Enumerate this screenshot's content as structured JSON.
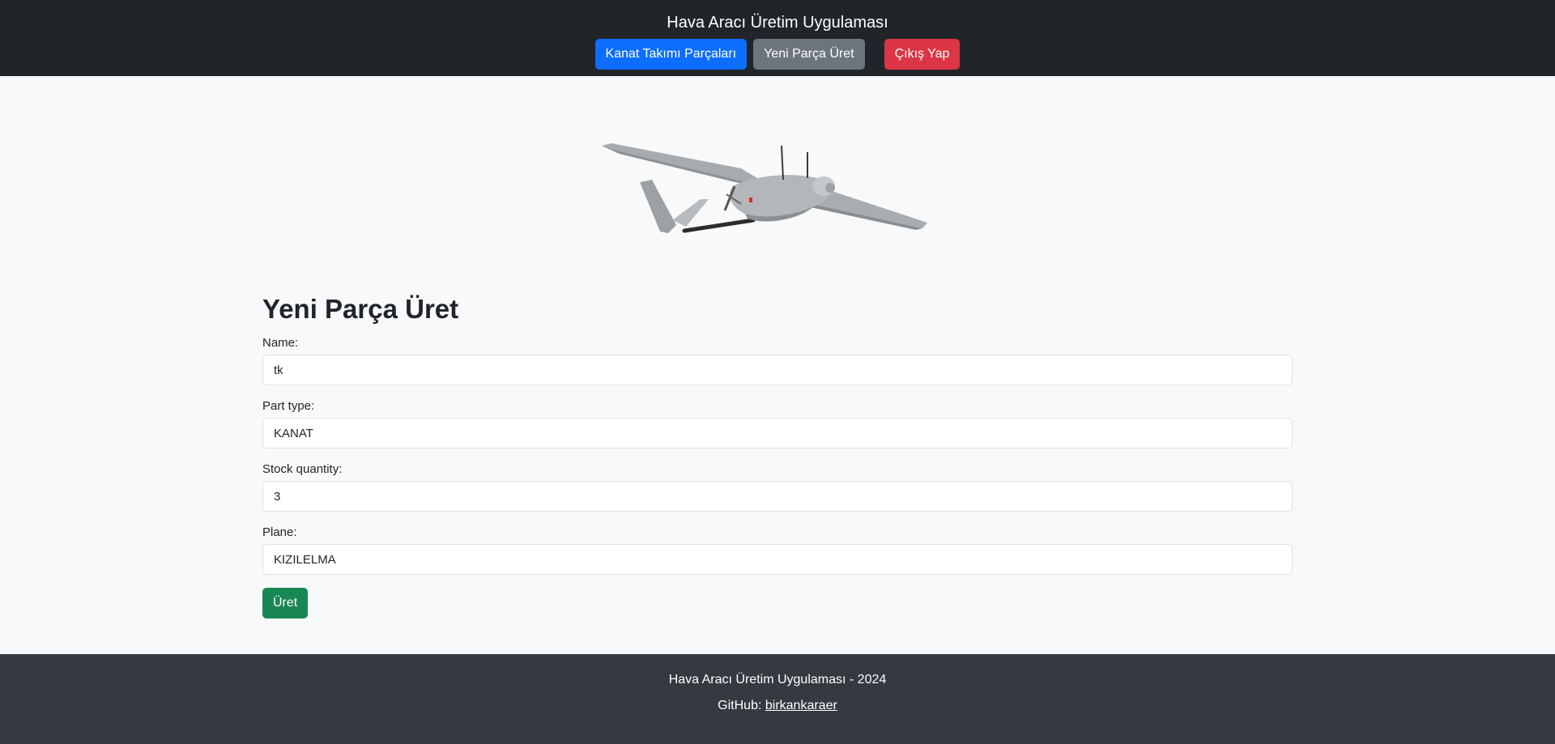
{
  "header": {
    "title": "Hava Aracı Üretim Uygulaması",
    "nav": {
      "parts_label": "Kanat Takımı Parçaları",
      "new_part_label": "Yeni Parça Üret",
      "logout_label": "Çıkış Yap"
    }
  },
  "hero": {
    "image_alt": "UAV image"
  },
  "form": {
    "title": "Yeni Parça Üret",
    "fields": {
      "name": {
        "label": "Name:",
        "value": "tk"
      },
      "part_type": {
        "label": "Part type:",
        "value": "KANAT"
      },
      "stock_quantity": {
        "label": "Stock quantity:",
        "value": "3"
      },
      "plane": {
        "label": "Plane:",
        "value": "KIZILELMA"
      }
    },
    "submit_label": "Üret"
  },
  "footer": {
    "copyright": "Hava Aracı Üretim Uygulaması - 2024",
    "github_prefix": "GitHub:",
    "github_link": "birkankaraer"
  },
  "colors": {
    "header_bg": "#212529",
    "footer_bg": "#343a40",
    "primary": "#0d6efd",
    "secondary": "#6c757d",
    "danger": "#dc3545",
    "success": "#198754",
    "page_bg": "#f8f9fa"
  }
}
